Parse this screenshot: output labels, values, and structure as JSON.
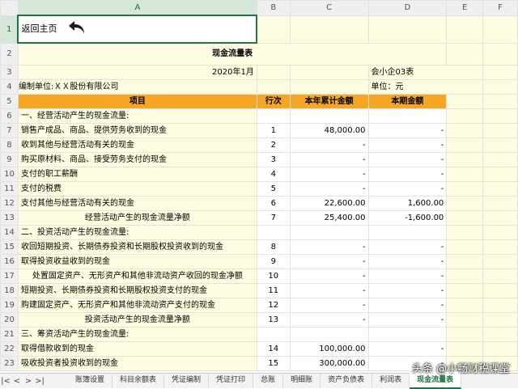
{
  "columns": [
    "A",
    "B",
    "C",
    "D",
    "E",
    "F"
  ],
  "home_label": "返回主页",
  "title": "现金流量表",
  "period": "2020年1月",
  "form_code": "会小企03表",
  "company": "编制单位:ＸＸ股份有限公司",
  "unit": "单位：元",
  "headers": {
    "item": "项目",
    "line": "行次",
    "ytd": "本年累计金额",
    "current": "本期金额"
  },
  "rows": [
    {
      "r": "6",
      "item": "一、经营活动产生的现金流量:",
      "line": "",
      "ytd": "",
      "cur": ""
    },
    {
      "r": "7",
      "item": "销售产成品、商品、提供劳务收到的现金",
      "line": "1",
      "ytd": "48,000.00",
      "cur": "-"
    },
    {
      "r": "8",
      "item": "收到其他与经营活动有关的现金",
      "line": "2",
      "ytd": "-",
      "cur": "-"
    },
    {
      "r": "9",
      "item": "购买原材料、商品、接受劳务支付的现金",
      "line": "3",
      "ytd": "-",
      "cur": "-"
    },
    {
      "r": "10",
      "item": "支付的职工薪酬",
      "line": "4",
      "ytd": "-",
      "cur": "-"
    },
    {
      "r": "11",
      "item": "支付的税费",
      "line": "5",
      "ytd": "-",
      "cur": "-"
    },
    {
      "r": "12",
      "item": "支付其他与经营活动有关的现金",
      "line": "6",
      "ytd": "22,600.00",
      "cur": "1,600.00"
    },
    {
      "r": "13",
      "item": "经营活动产生的现金流量净额",
      "line": "7",
      "ytd": "25,400.00",
      "cur": "-1,600.00"
    },
    {
      "r": "14",
      "item": "二、投资活动产生的现金流量:",
      "line": "",
      "ytd": "",
      "cur": ""
    },
    {
      "r": "15",
      "item": "收回短期投资、长期债券投资和长期股权投资收到的现金",
      "line": "8",
      "ytd": "-",
      "cur": "-"
    },
    {
      "r": "16",
      "item": "取得投资收益收到的现金",
      "line": "9",
      "ytd": "-",
      "cur": "-"
    },
    {
      "r": "17",
      "item": "处置固定资产、无形资产和其他非流动资产收回的现金净额",
      "line": "10",
      "ytd": "-",
      "cur": "-"
    },
    {
      "r": "18",
      "item": "短期投资、长期债券投资和长期股权投资支付的现金",
      "line": "11",
      "ytd": "-",
      "cur": "-"
    },
    {
      "r": "19",
      "item": "购建固定资产、无形资产和其他非流动资产支付的现金",
      "line": "12",
      "ytd": "-",
      "cur": "-"
    },
    {
      "r": "20",
      "item": "投资活动产生的现金流量净额",
      "line": "13",
      "ytd": "-",
      "cur": "-"
    },
    {
      "r": "21",
      "item": "三、筹资活动产生的现金流量:",
      "line": "",
      "ytd": "",
      "cur": ""
    },
    {
      "r": "22",
      "item": "取得借款收到的现金",
      "line": "14",
      "ytd": "100,000.00",
      "cur": "-"
    },
    {
      "r": "23",
      "item": "吸收投资者投资收到的现金",
      "line": "15",
      "ytd": "300,000.00",
      "cur": "-"
    }
  ],
  "row_numbers": [
    "1",
    "2",
    "3",
    "4",
    "5"
  ],
  "tabs": [
    "账簿设置",
    "科目余额表",
    "凭证编制",
    "凭证打印",
    "总账",
    "明细账",
    "资产负债表",
    "利润表",
    "现金流量表"
  ],
  "watermark": "头条 @小畅财税课堂"
}
